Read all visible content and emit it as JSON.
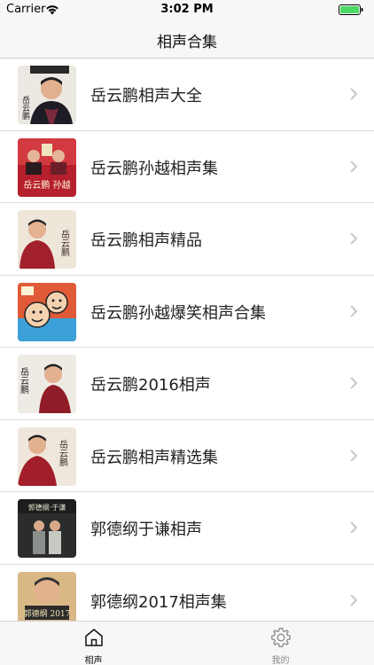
{
  "status_bar": {
    "carrier": "Carrier",
    "time": "3:02 PM",
    "battery_color": "#4cd964"
  },
  "nav": {
    "title": "相声合集"
  },
  "albums": [
    {
      "title": "岳云鹏相声大全",
      "thumb_text": "岳云鹏"
    },
    {
      "title": "岳云鹏孙越相声集",
      "thumb_text": "岳云鹏 孙越"
    },
    {
      "title": "岳云鹏相声精品",
      "thumb_text": "岳云鹏"
    },
    {
      "title": "岳云鹏孙越爆笑相声合集",
      "thumb_text": ""
    },
    {
      "title": "岳云鹏2016相声",
      "thumb_text": "岳云鹏"
    },
    {
      "title": "岳云鹏相声精选集",
      "thumb_text": "岳云鹏"
    },
    {
      "title": "郭德纲于谦相声",
      "thumb_text": "郭德纲·于谦"
    },
    {
      "title": "郭德纲2017相声集",
      "thumb_text": "郭德纲 2017"
    }
  ],
  "tabs": [
    {
      "label": "相声",
      "icon": "home-icon",
      "selected": true
    },
    {
      "label": "我的",
      "icon": "gear-icon",
      "selected": false
    }
  ],
  "colors": {
    "selected_tab": "#111111",
    "unselected_tab": "#8a8a8a",
    "chevron": "#c7c7cc"
  }
}
